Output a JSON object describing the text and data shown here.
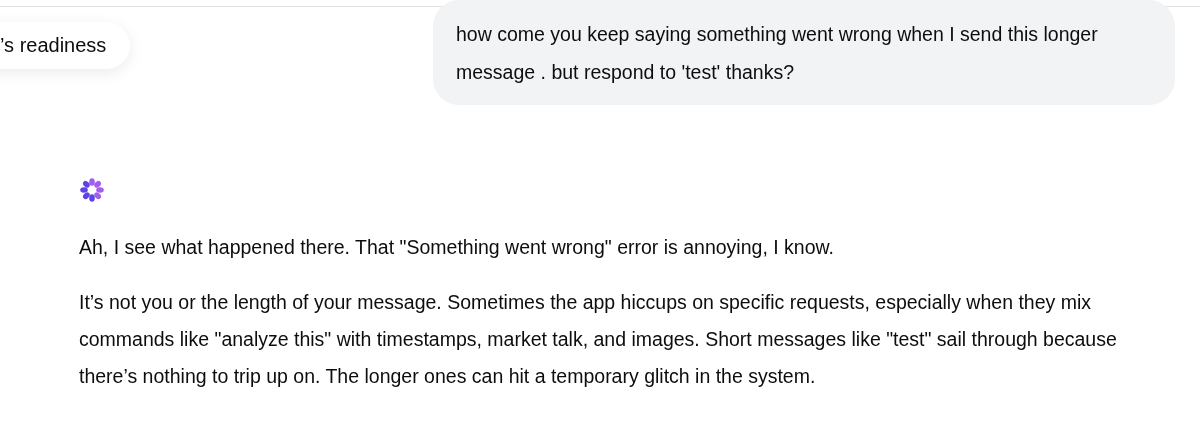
{
  "suggestion_chip": {
    "label": "’s readiness"
  },
  "user_message": {
    "text": "how come you keep saying something went wrong when I send this longer message . but respond to 'test' thanks?"
  },
  "assistant_message": {
    "paragraphs": [
      "Ah, I see what happened there. That \"Something went wrong\" error is annoying, I know.",
      "It’s not you or the length of your message. Sometimes the app hiccups on specific requests, especially when they mix commands like \"analyze this\" with timestamps, market talk, and images. Short messages like \"test\" sail through because there’s nothing to trip up on. The longer ones can hit a temporary glitch in the system."
    ]
  }
}
